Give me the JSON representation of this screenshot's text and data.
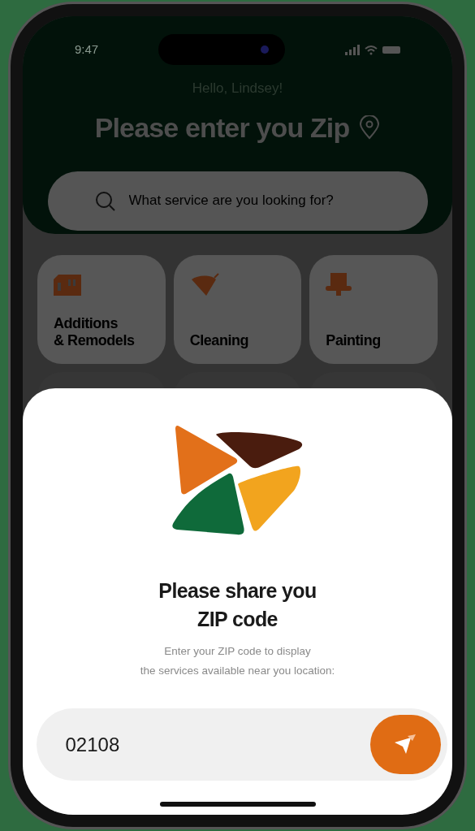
{
  "status_bar": {
    "time": "9:47"
  },
  "header": {
    "greeting": "Hello, Lindsey!",
    "title": "Please enter you Zip",
    "search": {
      "placeholder": "What service are you looking for?"
    }
  },
  "categories": [
    {
      "kind": "house",
      "label": "Additions\n& Remodels"
    },
    {
      "kind": "broom",
      "label": "Cleaning"
    },
    {
      "kind": "brush",
      "label": "Painting"
    }
  ],
  "zip_sheet": {
    "title": "Please share you\nZIP code",
    "description": "Enter your ZIP code to display\nthe services available near you location:",
    "zip_input": {
      "value": "02108"
    }
  }
}
